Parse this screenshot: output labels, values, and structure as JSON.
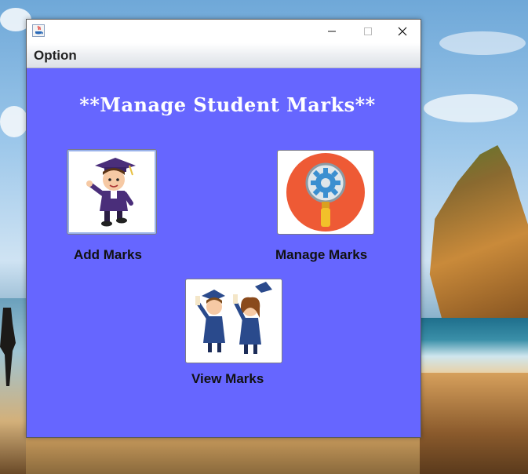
{
  "window": {
    "title": "",
    "controls": {
      "minimize_icon": "minimize-icon",
      "maximize_icon": "maximize-icon",
      "close_icon": "close-icon"
    }
  },
  "menubar": {
    "items": [
      {
        "label": "Option"
      }
    ]
  },
  "main": {
    "heading": "**Manage Student Marks**",
    "background_color": "#6666ff",
    "buttons": [
      {
        "label": "Add Marks",
        "icon": "graduate-student-icon"
      },
      {
        "label": "Manage Marks",
        "icon": "gear-magnifier-icon"
      },
      {
        "label": "View Marks",
        "icon": "graduates-celebrating-icon"
      }
    ]
  }
}
